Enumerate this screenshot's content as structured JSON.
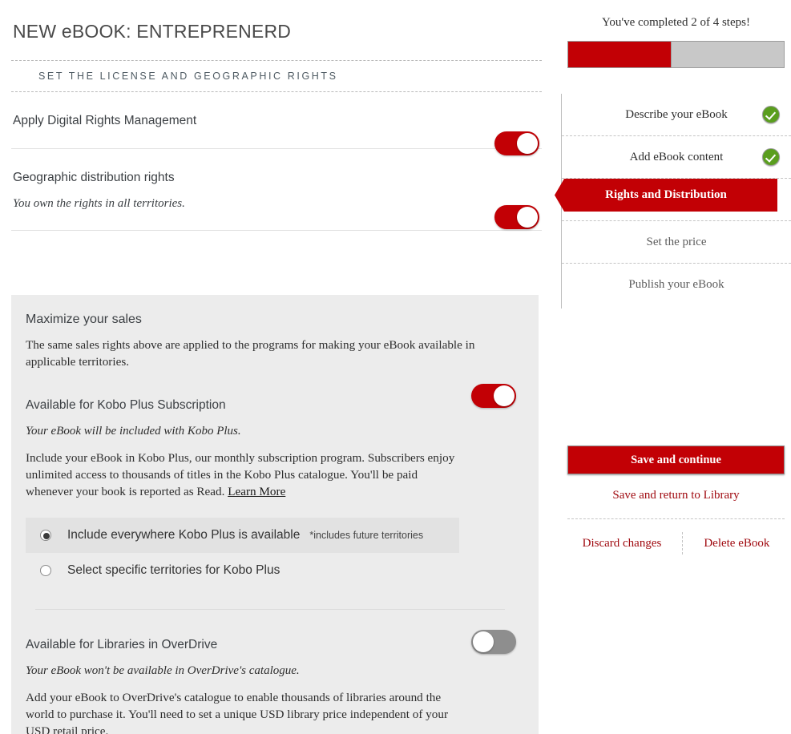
{
  "main": {
    "title": "NEW eBOOK: ENTREPRENERD",
    "section_header": "SET THE LICENSE AND GEOGRAPHIC RIGHTS",
    "rows": [
      {
        "label": "Apply Digital Rights Management",
        "toggle": "on"
      },
      {
        "label": "Geographic distribution rights",
        "sub": "You own the rights in all territories.",
        "toggle": "on"
      }
    ],
    "panel": {
      "title": "Maximize your sales",
      "intro": "The same sales rights above are applied to the programs for making your eBook available in applicable territories.",
      "kobo": {
        "label": "Available for Kobo Plus Subscription",
        "toggle": "on",
        "sub": "Your eBook will be included with Kobo Plus.",
        "body": "Include your eBook in Kobo Plus, our monthly subscription program. Subscribers enjoy unlimited access to thousands of titles in the Kobo Plus catalogue. You'll be paid whenever your book is reported as Read.",
        "learn_more": "Learn More",
        "options": [
          {
            "label": "Include everywhere Kobo Plus is available",
            "note": "*includes future territories",
            "selected": true
          },
          {
            "label": "Select specific territories for Kobo Plus",
            "note": "",
            "selected": false
          }
        ]
      },
      "overdrive": {
        "label": "Available for Libraries in OverDrive",
        "toggle": "off",
        "sub": "Your eBook won't be available in OverDrive's catalogue.",
        "body": "Add your eBook to OverDrive's catalogue to enable thousands of libraries around the world to purchase it. You'll need to set a unique USD library price independent of your USD retail price."
      }
    }
  },
  "sidebar": {
    "progress_text": "You've completed 2 of 4 steps!",
    "progress_percent": 48,
    "steps": [
      {
        "label": "Describe your eBook",
        "state": "done"
      },
      {
        "label": "Add eBook content",
        "state": "done"
      },
      {
        "label": "Rights and Distribution",
        "state": "active"
      },
      {
        "label": "Set the price",
        "state": "pending"
      },
      {
        "label": "Publish your eBook",
        "state": "pending"
      }
    ],
    "save_continue": "Save and continue",
    "save_return": "Save and return to Library",
    "discard": "Discard changes",
    "delete": "Delete eBook"
  },
  "colors": {
    "brand_red": "#c20005",
    "link_red": "#a00a10",
    "check_green": "#5a9e1e",
    "panel_gray": "#ececec",
    "toggle_off_gray": "#8e8e8e"
  }
}
